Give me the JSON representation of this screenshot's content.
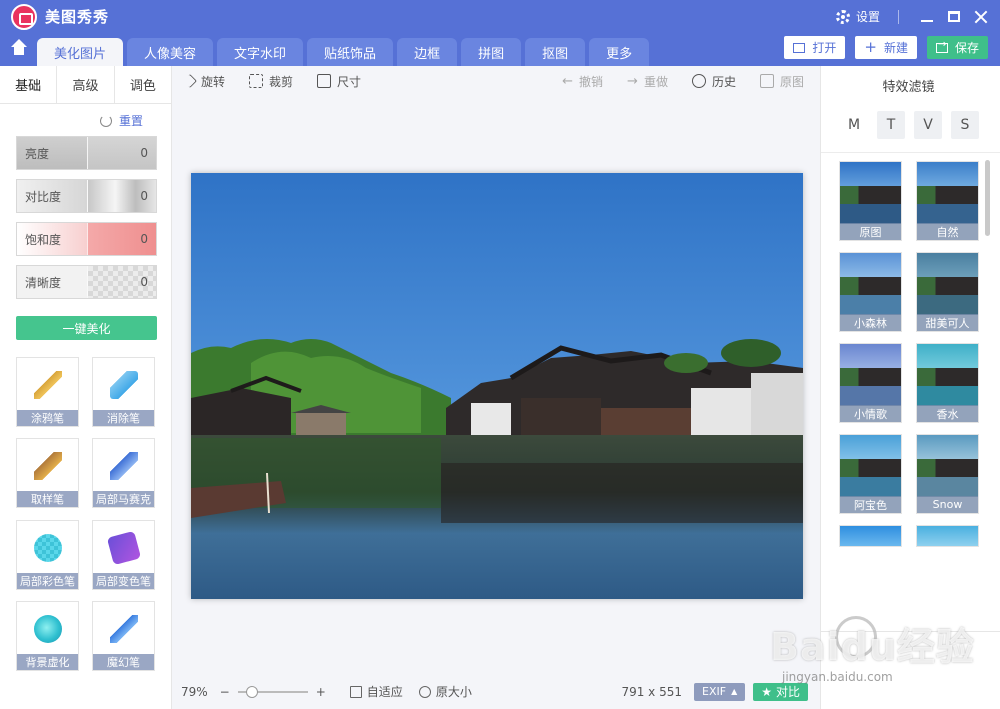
{
  "window": {
    "title": "美图秀秀",
    "settings_label": "设置"
  },
  "tabs": [
    {
      "label": "美化图片",
      "active": true
    },
    {
      "label": "人像美容",
      "active": false
    },
    {
      "label": "文字水印",
      "active": false
    },
    {
      "label": "贴纸饰品",
      "active": false
    },
    {
      "label": "边框",
      "active": false
    },
    {
      "label": "拼图",
      "active": false
    },
    {
      "label": "抠图",
      "active": false
    },
    {
      "label": "更多",
      "active": false
    }
  ],
  "actions": {
    "open": "打开",
    "new": "新建",
    "save": "保存"
  },
  "left": {
    "subtabs": [
      "基础",
      "高级",
      "调色"
    ],
    "reset": "重置",
    "sliders": [
      {
        "label": "亮度",
        "value": "0"
      },
      {
        "label": "对比度",
        "value": "0"
      },
      {
        "label": "饱和度",
        "value": "0"
      },
      {
        "label": "清晰度",
        "value": "0"
      }
    ],
    "one_key": "一键美化",
    "tools": [
      {
        "label": "涂鸦笔",
        "icon": "brush-icon"
      },
      {
        "label": "消除笔",
        "icon": "eraser-icon"
      },
      {
        "label": "取样笔",
        "icon": "sample-brush-icon"
      },
      {
        "label": "局部马赛克",
        "icon": "mosaic-brush-icon"
      },
      {
        "label": "局部彩色笔",
        "icon": "color-brush-icon"
      },
      {
        "label": "局部变色笔",
        "icon": "recolor-brush-icon"
      },
      {
        "label": "背景虚化",
        "icon": "background-blur-icon"
      },
      {
        "label": "魔幻笔",
        "icon": "magic-brush-icon"
      }
    ]
  },
  "toolbar": {
    "rotate": "旋转",
    "crop": "裁剪",
    "size": "尺寸",
    "undo": "撤销",
    "redo": "重做",
    "history": "历史",
    "original": "原图"
  },
  "status": {
    "zoom": "79%",
    "fit": "自适应",
    "actual": "原大小",
    "dimensions": "791 x 551",
    "exif": "EXIF",
    "compare": "对比"
  },
  "right": {
    "title": "特效滤镜",
    "categories": [
      "M",
      "T",
      "V",
      "S"
    ],
    "filters": [
      "原图",
      "自然",
      "小森林",
      "甜美可人",
      "小情歌",
      "香水",
      "阿宝色",
      "Snow"
    ]
  },
  "watermark": {
    "text": "Baidu经验",
    "url": "jingyan.baidu.com"
  }
}
